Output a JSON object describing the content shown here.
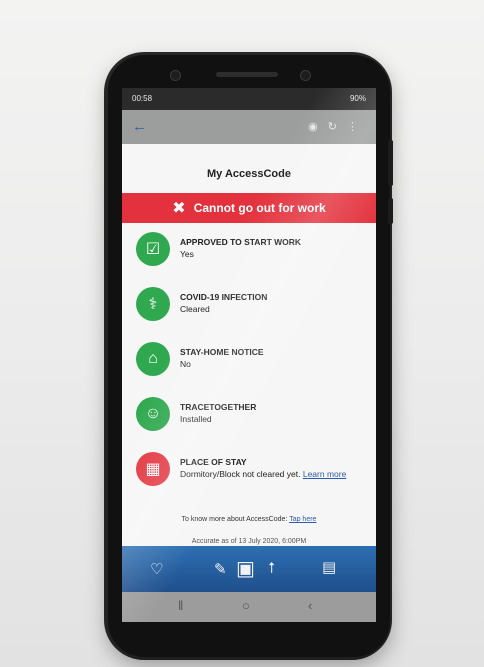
{
  "status_bar": {
    "time": "00:58",
    "battery": "90%"
  },
  "page_title": "My AccessCode",
  "alert": {
    "text": "Cannot go out for work",
    "color": "#e3323d"
  },
  "items": [
    {
      "title": "APPROVED TO START WORK",
      "value": "Yes",
      "status": "green",
      "icon": "clipboard-check-icon"
    },
    {
      "title": "COVID-19 INFECTION",
      "value": "Cleared",
      "status": "green",
      "icon": "test-swab-icon"
    },
    {
      "title": "STAY-HOME NOTICE",
      "value": "No",
      "status": "green",
      "icon": "home-person-icon"
    },
    {
      "title": "TRACETOGETHER",
      "value": "Installed",
      "status": "green",
      "icon": "tracetogether-icon"
    },
    {
      "title": "PLACE OF STAY",
      "value": "Dormitory/Block not cleared yet.",
      "link": "Learn more",
      "status": "red",
      "icon": "building-icon"
    }
  ],
  "footer": {
    "info_text": "To know more about AccessCode:",
    "info_link": "Tap here",
    "accurate_as_of": "Accurate as of 13 July 2020, 6:00PM"
  },
  "colors": {
    "green": "#2fa84f",
    "red": "#e3323d",
    "toolbar_blue": "#2d6fb3"
  }
}
